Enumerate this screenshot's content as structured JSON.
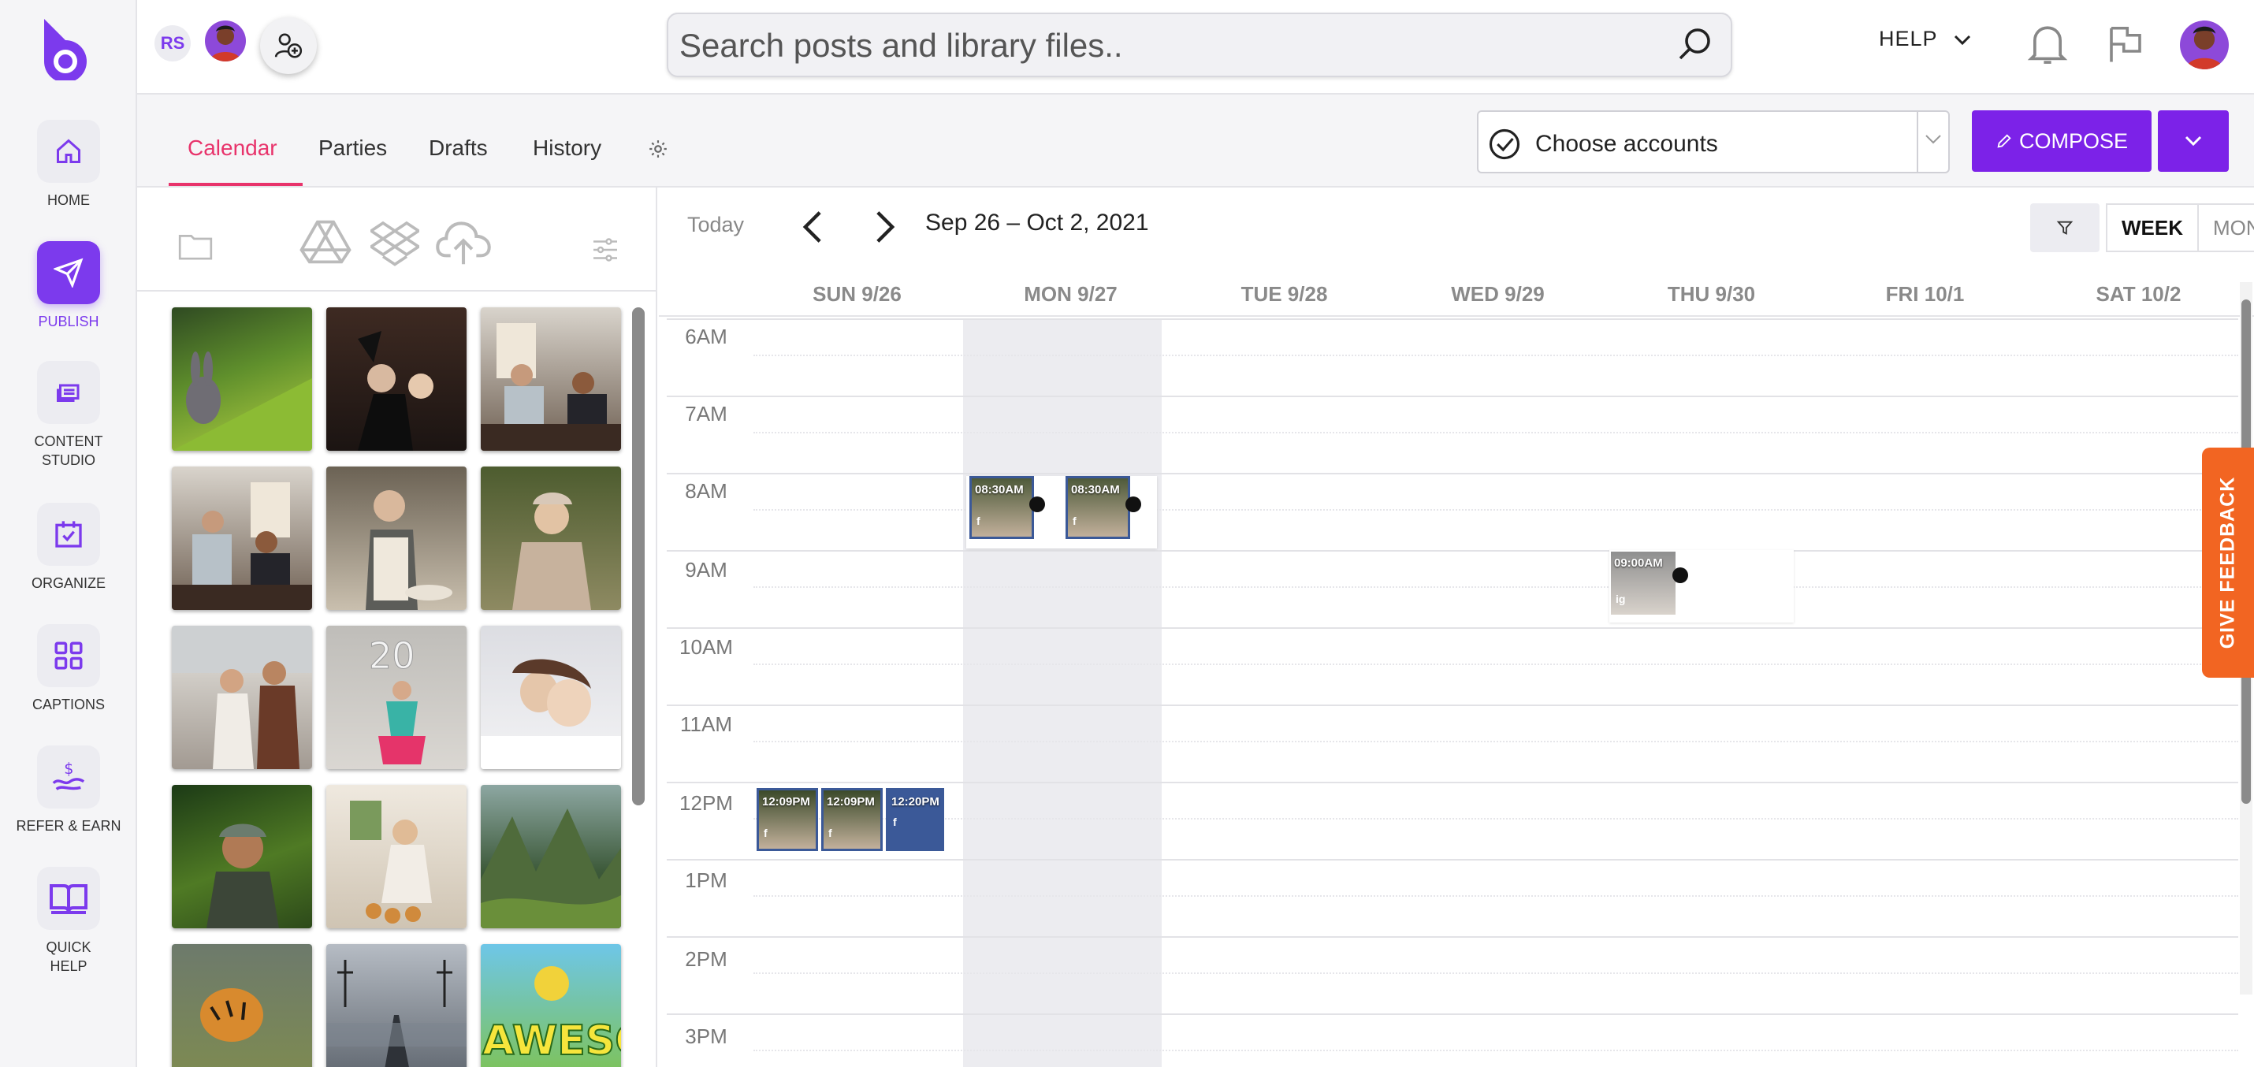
{
  "nav": {
    "items": [
      {
        "label": "HOME",
        "icon": "home-icon"
      },
      {
        "label": "PUBLISH",
        "icon": "paper-plane-icon"
      },
      {
        "label": "CONTENT STUDIO",
        "icon": "layers-icon"
      },
      {
        "label": "ORGANIZE",
        "icon": "calendar-check-icon"
      },
      {
        "label": "CAPTIONS",
        "icon": "grid-icon"
      },
      {
        "label": "REFER & EARN",
        "icon": "dollar-hand-icon"
      },
      {
        "label": "QUICK HELP",
        "icon": "book-icon"
      }
    ]
  },
  "header": {
    "initials": "RS",
    "search_placeholder": "Search posts and library files..",
    "help_label": "HELP"
  },
  "tabs": [
    {
      "label": "Calendar",
      "active": true
    },
    {
      "label": "Parties"
    },
    {
      "label": "Drafts"
    },
    {
      "label": "History"
    }
  ],
  "accounts": {
    "label": "Choose accounts"
  },
  "compose": {
    "label": "COMPOSE"
  },
  "calendar": {
    "today_label": "Today",
    "range": "Sep 26 – Oct 2, 2021",
    "views": {
      "week": "WEEK",
      "month": "MONTH"
    },
    "days": [
      "SUN 9/26",
      "MON 9/27",
      "TUE 9/28",
      "WED 9/29",
      "THU 9/30",
      "FRI 10/1",
      "SAT 10/2"
    ],
    "hours": [
      "6AM",
      "7AM",
      "8AM",
      "9AM",
      "10AM",
      "11AM",
      "12PM",
      "1PM",
      "2PM",
      "3PM"
    ],
    "posts": [
      {
        "time": "08:30AM",
        "network": "f"
      },
      {
        "time": "08:30AM",
        "network": "f"
      },
      {
        "time": "09:00AM",
        "network": "ig"
      },
      {
        "time": "12:09PM",
        "network": "f"
      },
      {
        "time": "12:09PM",
        "network": "f"
      },
      {
        "time": "12:20PM",
        "network": "f"
      }
    ]
  },
  "feedback": {
    "label": "GIVE FEEDBACK"
  },
  "colors": {
    "brand": "#7c22e8",
    "accent_tab": "#e8336b",
    "feedback": "#f26522",
    "facebook": "#3b5998"
  }
}
